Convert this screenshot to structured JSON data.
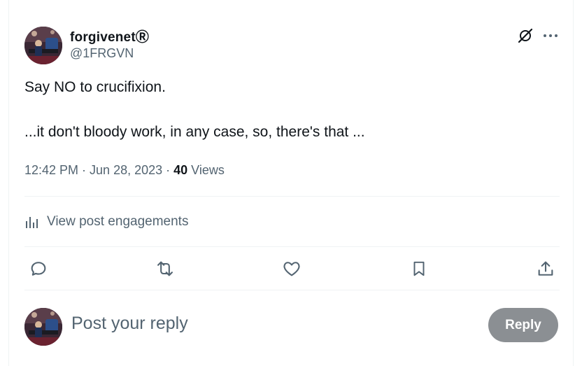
{
  "author": {
    "display_name": "forgivenet",
    "registered_mark": "Ⓡ",
    "handle": "@1FRGVN",
    "avatar": "avatar-icon"
  },
  "header_actions": {
    "grok_icon": "grok-icon",
    "more_icon": "more-icon"
  },
  "post": {
    "line1": "Say NO to crucifixion.",
    "line2": "...it don't bloody work, in any case, so, there's that ..."
  },
  "meta": {
    "time": "12:42 PM",
    "separator1": " · ",
    "date": "Jun 28, 2023",
    "separator2": " · ",
    "views_count": "40",
    "views_label": " Views"
  },
  "engagements": {
    "label": "View post engagements",
    "icon": "analytics-icon"
  },
  "actions": [
    {
      "name": "reply-action",
      "icon": "reply-icon"
    },
    {
      "name": "repost-action",
      "icon": "repost-icon"
    },
    {
      "name": "like-action",
      "icon": "heart-icon"
    },
    {
      "name": "bookmark-action",
      "icon": "bookmark-icon"
    },
    {
      "name": "share-action",
      "icon": "share-icon"
    }
  ],
  "composer": {
    "placeholder": "Post your reply",
    "button_label": "Reply"
  },
  "colors": {
    "text_primary": "#0f1419",
    "text_secondary": "#536471",
    "divider": "#eff3f4",
    "reply_button_disabled": "#8b8f93"
  }
}
